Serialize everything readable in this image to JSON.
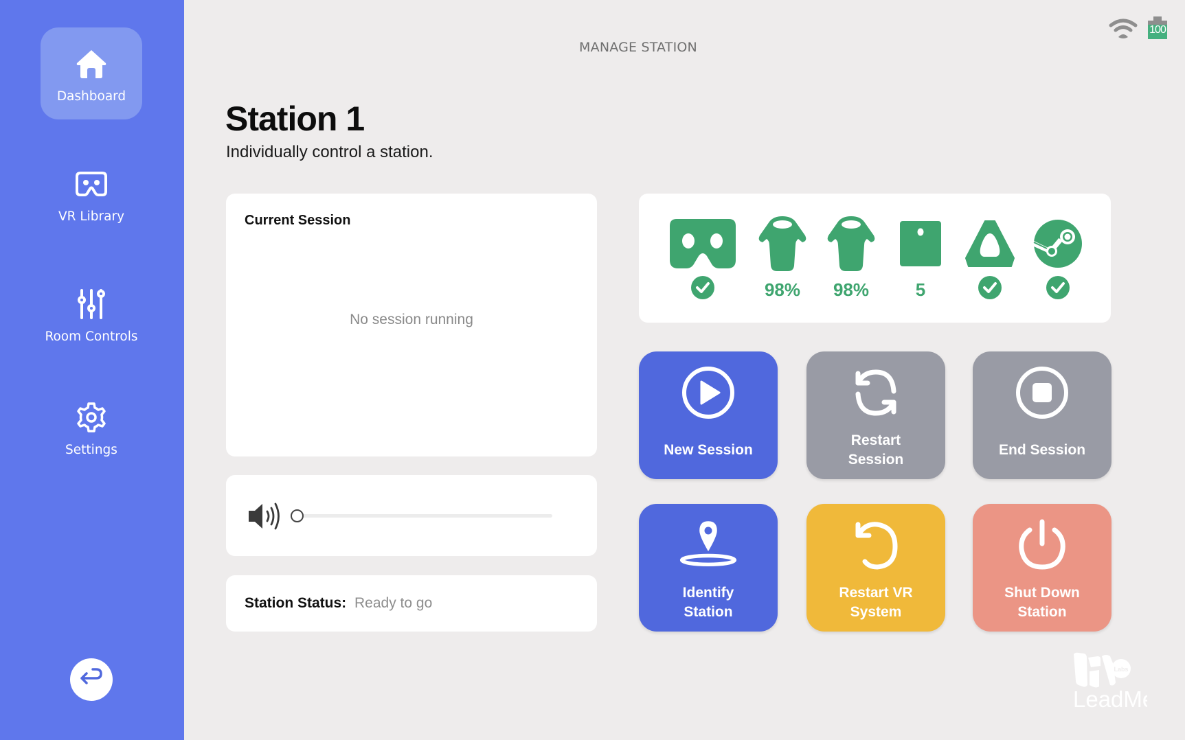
{
  "header": {
    "title": "MANAGE STATION"
  },
  "status_bar": {
    "wifi_icon": "wifi-icon",
    "battery_level": "100",
    "colors": {
      "battery": "#45b07f",
      "icons": "#8e8e8e"
    }
  },
  "sidebar": {
    "items": [
      {
        "label": "Dashboard",
        "icon": "home-icon",
        "active": true
      },
      {
        "label": "VR Library",
        "icon": "vr-headset-icon",
        "active": false
      },
      {
        "label": "Room Controls",
        "icon": "sliders-icon",
        "active": false
      },
      {
        "label": "Settings",
        "icon": "gear-icon",
        "active": false
      }
    ],
    "back_icon": "return-arrow-icon",
    "colors": {
      "background": "#5f77ec",
      "active": "#8299f0"
    }
  },
  "page": {
    "title": "Station 1",
    "subtitle": "Individually control a station."
  },
  "session": {
    "title": "Current Session",
    "empty_text": "No session running"
  },
  "volume": {
    "icon": "speaker-icon",
    "level_percent": 0
  },
  "station_status": {
    "label": "Station Status:",
    "value": "Ready to go"
  },
  "devices": {
    "color": "#3fa56f",
    "items": [
      {
        "name": "headset",
        "icon": "vr-headset-icon",
        "status": "check"
      },
      {
        "name": "left-controller",
        "icon": "controller-icon",
        "status": "98%"
      },
      {
        "name": "right-controller",
        "icon": "controller-icon",
        "status": "98%"
      },
      {
        "name": "trackers",
        "icon": "tracker-icon",
        "status": "5"
      },
      {
        "name": "base-station",
        "icon": "base-station-icon",
        "status": "check"
      },
      {
        "name": "steam",
        "icon": "steam-icon",
        "status": "check"
      }
    ]
  },
  "actions": [
    {
      "label": "New Session",
      "icon": "play-circle-icon",
      "color": "#5068dd"
    },
    {
      "label": "Restart\nSession",
      "icon": "refresh-icon",
      "color": "#999ba5"
    },
    {
      "label": "End Session",
      "icon": "stop-circle-icon",
      "color": "#999ba5"
    },
    {
      "label": "Identify\nStation",
      "icon": "location-pin-icon",
      "color": "#5068dd"
    },
    {
      "label": "Restart VR\nSystem",
      "icon": "restart-icon",
      "color": "#f0b93a"
    },
    {
      "label": "Shut Down\nStation",
      "icon": "power-icon",
      "color": "#eb9585"
    }
  ],
  "brand": {
    "name": "LeadMe",
    "badge": "Labs"
  }
}
